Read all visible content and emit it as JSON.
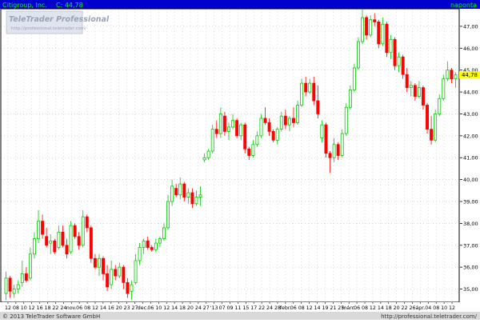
{
  "header": {
    "instrument": "Citigroup, Inc.",
    "last_label": "C: 44,78",
    "period": "naponta"
  },
  "watermark": {
    "brand": "TeleTrader Professional",
    "url": "http://professional.teletrader.com/"
  },
  "footer": {
    "copyright": "© 2013 TeleTrader Software GmbH",
    "url": "http://professional.teletrader.com/"
  },
  "colors": {
    "header_bg": "#0000cc",
    "header_text": "#ffffff",
    "header_accent": "#00ff00",
    "up": "#00cc00",
    "down": "#ff0000",
    "grid": "#c8c8c8",
    "last_box": "#ffff00",
    "axis_bg": "#e8e8e8"
  },
  "chart_data": {
    "type": "candlestick",
    "ylim": [
      34.4,
      47.8
    ],
    "y_ticks": [
      "35,00",
      "36,00",
      "37,00",
      "38,00",
      "39,00",
      "40,00",
      "41,00",
      "42,00",
      "43,00",
      "44,00",
      "45,00",
      "46,00",
      "47,00"
    ],
    "y_tick_values": [
      35,
      36,
      37,
      38,
      39,
      40,
      41,
      42,
      43,
      44,
      45,
      46,
      47
    ],
    "last_value": 44.78,
    "last_label": "44,78",
    "x_tick_labels": [
      "12",
      "08",
      "10",
      "12",
      "16",
      "18",
      "22",
      "24",
      "nov.",
      "06",
      "08",
      "12",
      "14",
      "16",
      "20",
      "23",
      "27",
      "dec.",
      "06",
      "10",
      "12",
      "14",
      "18",
      "20",
      "24",
      "27",
      "'13",
      "07",
      "09",
      "11",
      "15",
      "17",
      "22",
      "24",
      "28",
      "febr.",
      "06",
      "08",
      "12",
      "14",
      "19",
      "21",
      "25",
      "márc.",
      "06",
      "08",
      "12",
      "14",
      "18",
      "20",
      "22",
      "26",
      "ápr.",
      "04",
      "08",
      "10",
      "12"
    ],
    "candles": [
      {
        "o": 34.8,
        "h": 35.8,
        "l": 34.5,
        "c": 35.5
      },
      {
        "o": 35.5,
        "h": 35.6,
        "l": 34.6,
        "c": 34.9
      },
      {
        "o": 34.8,
        "h": 35.2,
        "l": 34.6,
        "c": 35.0
      },
      {
        "o": 35.0,
        "h": 35.4,
        "l": 34.8,
        "c": 35.2
      },
      {
        "o": 35.3,
        "h": 36.3,
        "l": 35.1,
        "c": 35.7
      },
      {
        "o": 35.7,
        "h": 36.0,
        "l": 35.3,
        "c": 35.4
      },
      {
        "o": 35.5,
        "h": 36.9,
        "l": 35.4,
        "c": 36.6
      },
      {
        "o": 36.6,
        "h": 37.6,
        "l": 36.4,
        "c": 37.3
      },
      {
        "o": 37.3,
        "h": 38.6,
        "l": 37.1,
        "c": 38.1
      },
      {
        "o": 38.1,
        "h": 38.4,
        "l": 37.3,
        "c": 37.5
      },
      {
        "o": 37.4,
        "h": 37.8,
        "l": 36.9,
        "c": 37.0
      },
      {
        "o": 37.1,
        "h": 37.5,
        "l": 36.6,
        "c": 37.2
      },
      {
        "o": 37.2,
        "h": 37.3,
        "l": 36.6,
        "c": 36.7
      },
      {
        "o": 36.9,
        "h": 37.9,
        "l": 36.8,
        "c": 37.6
      },
      {
        "o": 37.6,
        "h": 37.9,
        "l": 36.9,
        "c": 37.0
      },
      {
        "o": 37.0,
        "h": 37.3,
        "l": 36.4,
        "c": 36.6
      },
      {
        "o": 36.7,
        "h": 38.1,
        "l": 36.6,
        "c": 37.9
      },
      {
        "o": 37.9,
        "h": 38.0,
        "l": 37.3,
        "c": 37.4
      },
      {
        "o": 37.4,
        "h": 37.6,
        "l": 36.8,
        "c": 37.0
      },
      {
        "o": 37.0,
        "h": 38.6,
        "l": 36.9,
        "c": 38.3
      },
      {
        "o": 38.3,
        "h": 38.4,
        "l": 37.6,
        "c": 37.8
      },
      {
        "o": 37.8,
        "h": 37.9,
        "l": 36.2,
        "c": 36.4
      },
      {
        "o": 36.4,
        "h": 36.6,
        "l": 35.9,
        "c": 36.0
      },
      {
        "o": 36.0,
        "h": 36.6,
        "l": 35.6,
        "c": 36.4
      },
      {
        "o": 36.4,
        "h": 36.5,
        "l": 35.4,
        "c": 35.7
      },
      {
        "o": 35.7,
        "h": 36.1,
        "l": 34.9,
        "c": 35.1
      },
      {
        "o": 35.2,
        "h": 36.3,
        "l": 35.0,
        "c": 35.9
      },
      {
        "o": 35.9,
        "h": 36.1,
        "l": 35.4,
        "c": 35.6
      },
      {
        "o": 35.6,
        "h": 36.2,
        "l": 35.5,
        "c": 36.0
      },
      {
        "o": 36.0,
        "h": 36.1,
        "l": 35.0,
        "c": 35.3
      },
      {
        "o": 35.3,
        "h": 35.5,
        "l": 34.6,
        "c": 34.8
      },
      {
        "o": 34.9,
        "h": 35.4,
        "l": 34.5,
        "c": 35.2
      },
      {
        "o": 35.3,
        "h": 36.6,
        "l": 35.2,
        "c": 36.3
      },
      {
        "o": 36.3,
        "h": 37.1,
        "l": 36.1,
        "c": 36.9
      },
      {
        "o": 36.9,
        "h": 37.3,
        "l": 36.6,
        "c": 37.2
      },
      {
        "o": 37.2,
        "h": 37.4,
        "l": 36.8,
        "c": 36.9
      },
      {
        "o": 36.9,
        "h": 37.0,
        "l": 36.7,
        "c": 36.8
      },
      {
        "o": 36.8,
        "h": 37.3,
        "l": 36.7,
        "c": 37.1
      },
      {
        "o": 37.1,
        "h": 37.4,
        "l": 36.9,
        "c": 37.3
      },
      {
        "o": 37.3,
        "h": 38.0,
        "l": 37.2,
        "c": 37.8
      },
      {
        "o": 37.8,
        "h": 39.3,
        "l": 37.7,
        "c": 39.0
      },
      {
        "o": 39.0,
        "h": 40.0,
        "l": 38.8,
        "c": 39.7
      },
      {
        "o": 39.6,
        "h": 39.8,
        "l": 39.2,
        "c": 39.3
      },
      {
        "o": 39.3,
        "h": 40.1,
        "l": 39.1,
        "c": 39.8
      },
      {
        "o": 39.8,
        "h": 39.9,
        "l": 39.0,
        "c": 39.2
      },
      {
        "o": 39.2,
        "h": 39.6,
        "l": 38.9,
        "c": 39.4
      },
      {
        "o": 39.4,
        "h": 39.6,
        "l": 38.7,
        "c": 38.9
      },
      {
        "o": 38.9,
        "h": 39.5,
        "l": 38.8,
        "c": 39.2
      },
      {
        "o": 39.2,
        "h": 39.7,
        "l": 38.8,
        "c": 39.3
      },
      {
        "o": 40.9,
        "h": 41.2,
        "l": 40.8,
        "c": 41.0
      },
      {
        "o": 41.0,
        "h": 41.4,
        "l": 40.9,
        "c": 41.3
      },
      {
        "o": 41.3,
        "h": 42.5,
        "l": 41.2,
        "c": 42.3
      },
      {
        "o": 42.3,
        "h": 42.7,
        "l": 41.9,
        "c": 42.1
      },
      {
        "o": 42.1,
        "h": 43.3,
        "l": 41.9,
        "c": 43.0
      },
      {
        "o": 42.9,
        "h": 43.1,
        "l": 42.0,
        "c": 42.2
      },
      {
        "o": 42.2,
        "h": 42.6,
        "l": 41.8,
        "c": 42.4
      },
      {
        "o": 42.4,
        "h": 43.0,
        "l": 42.3,
        "c": 42.7
      },
      {
        "o": 42.7,
        "h": 42.8,
        "l": 41.9,
        "c": 42.0
      },
      {
        "o": 42.0,
        "h": 42.6,
        "l": 41.8,
        "c": 42.5
      },
      {
        "o": 42.5,
        "h": 42.6,
        "l": 41.2,
        "c": 41.4
      },
      {
        "o": 41.4,
        "h": 41.5,
        "l": 40.9,
        "c": 41.1
      },
      {
        "o": 41.1,
        "h": 41.8,
        "l": 41.0,
        "c": 41.6
      },
      {
        "o": 41.6,
        "h": 42.2,
        "l": 41.5,
        "c": 42.0
      },
      {
        "o": 42.0,
        "h": 43.0,
        "l": 41.9,
        "c": 42.8
      },
      {
        "o": 42.8,
        "h": 43.3,
        "l": 42.5,
        "c": 42.6
      },
      {
        "o": 42.6,
        "h": 42.8,
        "l": 42.0,
        "c": 42.2
      },
      {
        "o": 42.2,
        "h": 42.3,
        "l": 41.7,
        "c": 41.8
      },
      {
        "o": 41.8,
        "h": 42.4,
        "l": 41.6,
        "c": 42.3
      },
      {
        "o": 42.3,
        "h": 43.1,
        "l": 42.2,
        "c": 42.9
      },
      {
        "o": 42.9,
        "h": 43.2,
        "l": 42.3,
        "c": 42.5
      },
      {
        "o": 42.5,
        "h": 42.9,
        "l": 42.2,
        "c": 42.8
      },
      {
        "o": 42.8,
        "h": 43.3,
        "l": 42.4,
        "c": 42.6
      },
      {
        "o": 42.6,
        "h": 43.6,
        "l": 42.5,
        "c": 43.4
      },
      {
        "o": 43.4,
        "h": 44.6,
        "l": 43.3,
        "c": 44.4
      },
      {
        "o": 44.4,
        "h": 44.7,
        "l": 43.8,
        "c": 44.0
      },
      {
        "o": 44.0,
        "h": 44.6,
        "l": 43.9,
        "c": 44.4
      },
      {
        "o": 44.4,
        "h": 44.7,
        "l": 43.4,
        "c": 43.6
      },
      {
        "o": 43.6,
        "h": 44.3,
        "l": 42.8,
        "c": 43.0
      },
      {
        "o": 41.9,
        "h": 42.7,
        "l": 41.7,
        "c": 42.5
      },
      {
        "o": 42.5,
        "h": 42.6,
        "l": 41.0,
        "c": 41.2
      },
      {
        "o": 41.2,
        "h": 41.3,
        "l": 40.3,
        "c": 41.0
      },
      {
        "o": 41.0,
        "h": 41.9,
        "l": 40.8,
        "c": 41.6
      },
      {
        "o": 41.6,
        "h": 41.7,
        "l": 40.9,
        "c": 41.1
      },
      {
        "o": 41.1,
        "h": 42.3,
        "l": 41.0,
        "c": 42.1
      },
      {
        "o": 42.1,
        "h": 43.5,
        "l": 42.0,
        "c": 43.3
      },
      {
        "o": 43.3,
        "h": 44.3,
        "l": 43.2,
        "c": 44.1
      },
      {
        "o": 44.1,
        "h": 45.3,
        "l": 44.0,
        "c": 45.1
      },
      {
        "o": 45.1,
        "h": 46.5,
        "l": 45.0,
        "c": 46.3
      },
      {
        "o": 46.3,
        "h": 47.8,
        "l": 46.2,
        "c": 47.4
      },
      {
        "o": 47.4,
        "h": 47.5,
        "l": 46.4,
        "c": 46.6
      },
      {
        "o": 46.6,
        "h": 47.5,
        "l": 46.5,
        "c": 47.3
      },
      {
        "o": 47.3,
        "h": 47.6,
        "l": 47.0,
        "c": 47.2
      },
      {
        "o": 47.2,
        "h": 47.3,
        "l": 46.0,
        "c": 46.2
      },
      {
        "o": 46.2,
        "h": 47.4,
        "l": 46.1,
        "c": 47.1
      },
      {
        "o": 47.1,
        "h": 47.2,
        "l": 45.6,
        "c": 45.8
      },
      {
        "o": 45.8,
        "h": 46.6,
        "l": 45.5,
        "c": 46.4
      },
      {
        "o": 46.4,
        "h": 46.5,
        "l": 45.0,
        "c": 45.2
      },
      {
        "o": 45.2,
        "h": 45.8,
        "l": 44.9,
        "c": 45.6
      },
      {
        "o": 45.6,
        "h": 45.7,
        "l": 44.6,
        "c": 44.8
      },
      {
        "o": 44.8,
        "h": 45.1,
        "l": 44.0,
        "c": 44.2
      },
      {
        "o": 44.2,
        "h": 44.5,
        "l": 43.8,
        "c": 44.3
      },
      {
        "o": 44.3,
        "h": 44.4,
        "l": 43.6,
        "c": 43.8
      },
      {
        "o": 43.8,
        "h": 44.5,
        "l": 43.7,
        "c": 44.2
      },
      {
        "o": 44.2,
        "h": 44.3,
        "l": 43.2,
        "c": 43.4
      },
      {
        "o": 43.4,
        "h": 43.5,
        "l": 42.1,
        "c": 42.3
      },
      {
        "o": 42.3,
        "h": 42.9,
        "l": 41.6,
        "c": 41.8
      },
      {
        "o": 41.8,
        "h": 43.2,
        "l": 41.7,
        "c": 43.0
      },
      {
        "o": 43.0,
        "h": 43.9,
        "l": 42.9,
        "c": 43.7
      },
      {
        "o": 43.7,
        "h": 44.8,
        "l": 43.6,
        "c": 44.6
      },
      {
        "o": 44.6,
        "h": 45.4,
        "l": 44.5,
        "c": 45.0
      },
      {
        "o": 45.0,
        "h": 45.1,
        "l": 44.4,
        "c": 44.6
      },
      {
        "o": 44.6,
        "h": 44.9,
        "l": 44.2,
        "c": 44.78
      }
    ]
  }
}
